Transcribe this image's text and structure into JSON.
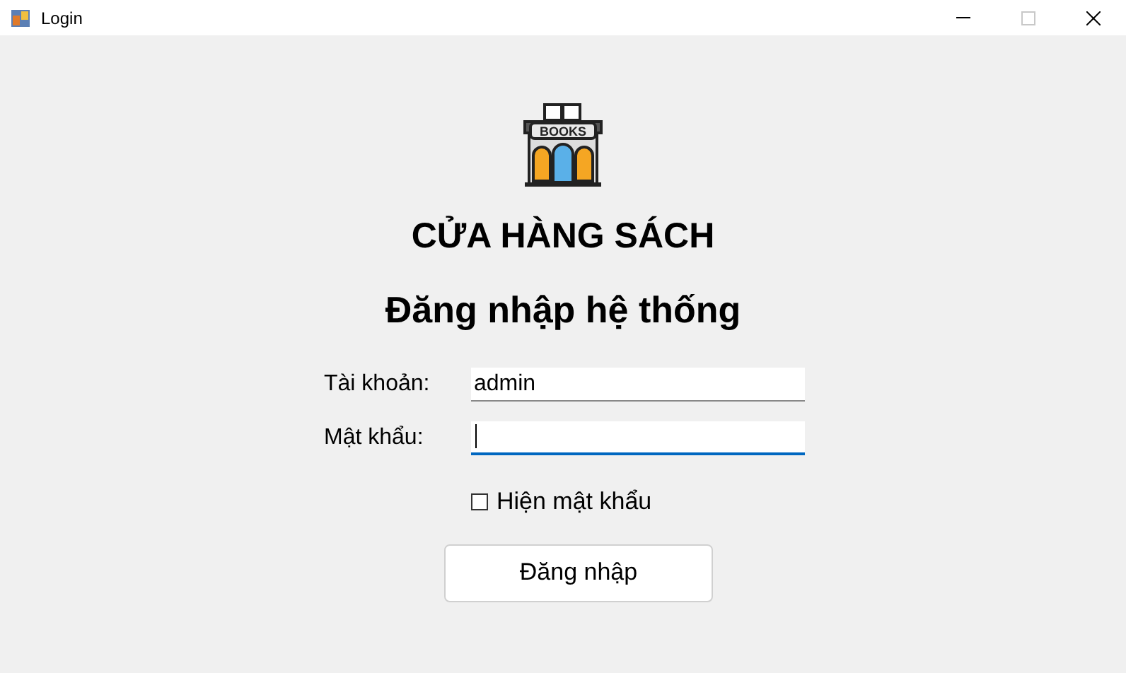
{
  "window": {
    "title": "Login",
    "maximize_disabled": true
  },
  "logo": {
    "sign": "BOOKS"
  },
  "heading": "CỬA HÀNG SÁCH",
  "subheading": "Đăng nhập hệ thống",
  "fields": [
    {
      "label": "Tài khoản:",
      "value": "admin",
      "focused": false
    },
    {
      "label": "Mật khẩu:",
      "focused": true
    }
  ],
  "show_password": {
    "label": "Hiện mật khẩu",
    "checked": false
  },
  "buttons": [
    "Đăng nhập"
  ]
}
